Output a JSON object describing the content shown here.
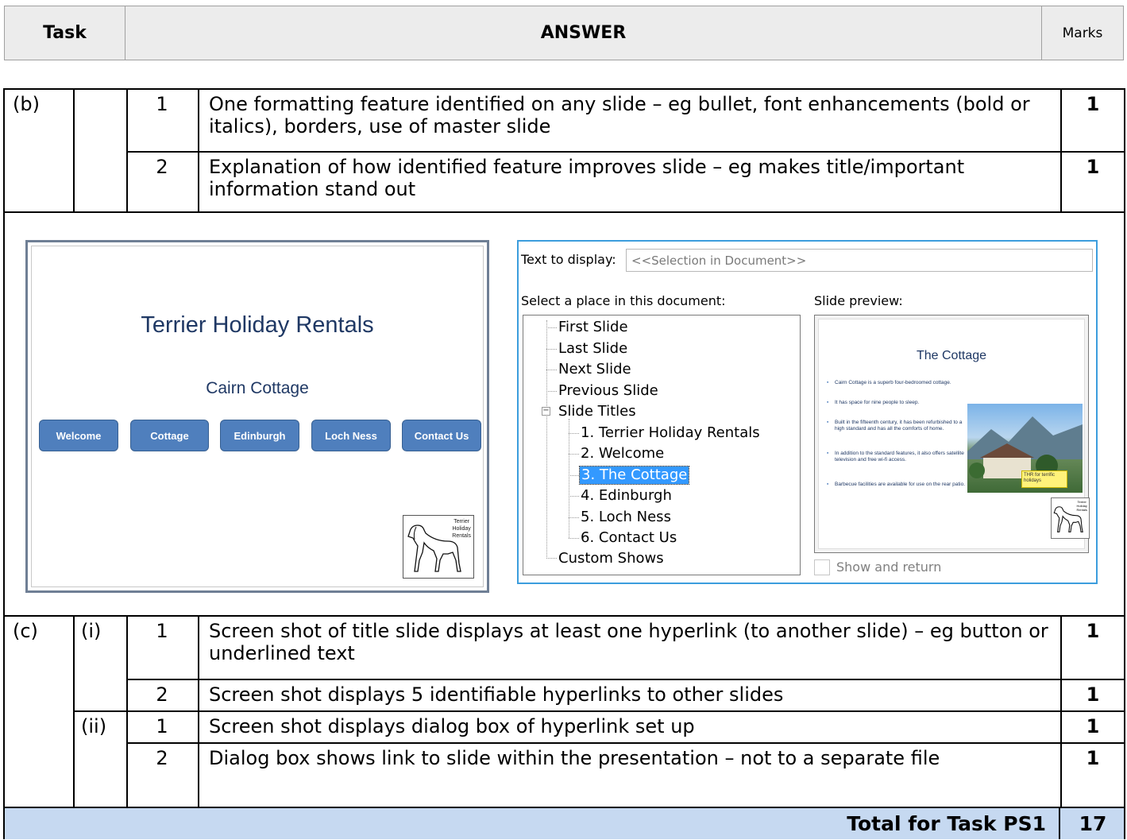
{
  "header": {
    "task": "Task",
    "answer": "ANSWER",
    "marks": "Marks"
  },
  "part_b": {
    "label": "(b)",
    "rows": [
      {
        "num": "1",
        "text": "One formatting feature identified on any slide – eg bullet, font enhancements (bold or italics), borders, use of master slide",
        "mark": "1"
      },
      {
        "num": "2",
        "text": "Explanation of how identified feature improves slide – eg makes title/important information stand out",
        "mark": "1"
      }
    ]
  },
  "slide": {
    "title": "Terrier Holiday Rentals",
    "subtitle": "Cairn Cottage",
    "buttons": [
      "Welcome",
      "Cottage",
      "Edinburgh",
      "Loch Ness",
      "Contact Us"
    ],
    "logo_text": [
      "Terrier",
      "Holiday",
      "Rentals"
    ],
    "button_color": "#4f7fbd",
    "title_color": "#1f3864"
  },
  "dialog": {
    "text_to_display_label": "Text to display:",
    "text_to_display_value": "<<Selection in Document>>",
    "select_place_label": "Select a place in this document:",
    "slide_preview_label": "Slide preview:",
    "tree": {
      "first": "First Slide",
      "last": "Last Slide",
      "next": "Next Slide",
      "previous": "Previous Slide",
      "titles_group": "Slide Titles",
      "titles": [
        "1. Terrier Holiday Rentals",
        "2. Welcome",
        "3. The Cottage",
        "4. Edinburgh",
        "5. Loch Ness",
        "6. Contact Us"
      ],
      "selected_index": 2,
      "custom": "Custom Shows"
    },
    "preview": {
      "title": "The Cottage",
      "bullets": [
        "Cairn Cottage is a superb four-bedroomed cottage.",
        "It has space for nine people to sleep.",
        "Built in the fifteenth century, it has been refurbished to a high standard and has all the comforts of home.",
        "In addition to the standard features, it also offers satellite television and free wi-fi access.",
        "Barbecue facilities are available for use on the rear patio."
      ],
      "note": "THR for terrific holidays",
      "logo_text": [
        "Terrier",
        "Holiday",
        "Rentals"
      ]
    },
    "show_and_return_label": "Show and return",
    "show_and_return_checked": false
  },
  "part_c": {
    "label": "(c)",
    "groups": [
      {
        "label": "(i)",
        "rows": [
          {
            "num": "1",
            "text": "Screen shot of title slide displays at least one hyperlink (to another slide) – eg button or underlined text",
            "mark": "1"
          },
          {
            "num": "2",
            "text": "Screen shot displays 5 identifiable hyperlinks to other slides",
            "mark": "1"
          }
        ]
      },
      {
        "label": "(ii)",
        "rows": [
          {
            "num": "1",
            "text": "Screen shot displays dialog box of hyperlink set up",
            "mark": "1"
          },
          {
            "num": "2",
            "text": "Dialog box shows link to slide within the presentation – not to a separate file",
            "mark": "1"
          }
        ]
      }
    ]
  },
  "total": {
    "label": "Total for Task PS1",
    "value": "17"
  }
}
